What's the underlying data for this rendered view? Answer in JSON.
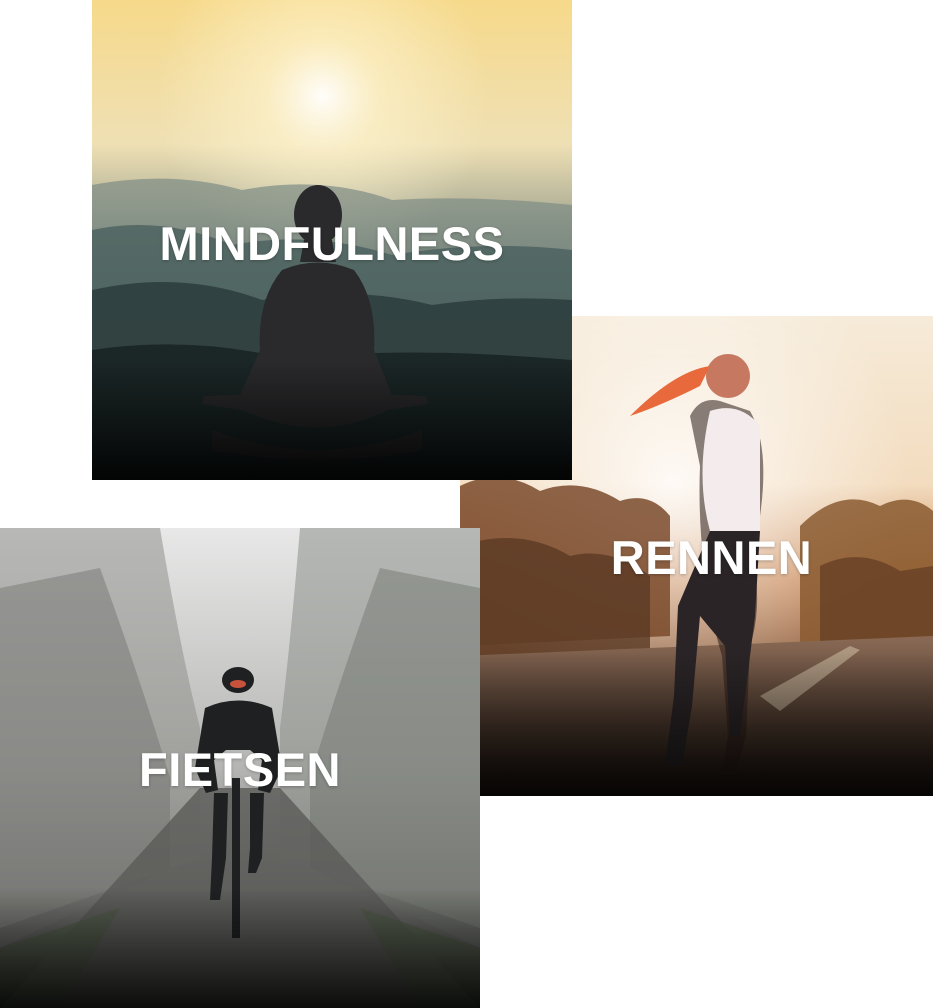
{
  "cards": [
    {
      "id": "rennen",
      "title": "RENNEN",
      "photo_icon": "woman-running-icon"
    },
    {
      "id": "mindfulness",
      "title": "MINDFULNESS",
      "photo_icon": "meditation-icon"
    },
    {
      "id": "fietsen",
      "title": "FIETSEN",
      "photo_icon": "cyclist-icon"
    }
  ],
  "colors": {
    "label_text": "#ffffff",
    "background": "#ffffff"
  }
}
